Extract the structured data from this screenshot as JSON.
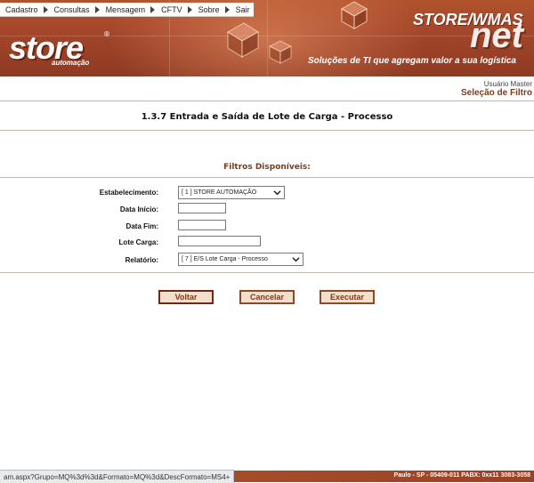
{
  "menu": {
    "items": [
      "Cadastro",
      "Consultas",
      "Mensagem",
      "CFTV",
      "Sobre",
      "Sair"
    ]
  },
  "brand": {
    "logo": "store",
    "logo_reg": "®",
    "logo_sub": "automação",
    "product_top": "STORE/WMAS",
    "product_bottom": "net",
    "tagline": "Soluções de TI que agregam valor a sua logística"
  },
  "header": {
    "user": "Usuário Master",
    "section": "Seleção de Filtro"
  },
  "page": {
    "title": "1.3.7 Entrada e Saída de Lote de Carga - Processo",
    "filters_title": "Filtros Disponíveis:"
  },
  "form": {
    "estabelecimento_label": "Estabelecimento:",
    "estabelecimento_value": "[ 1 ] STORE AUTOMAÇÃO",
    "data_inicio_label": "Data Início:",
    "data_inicio_value": "",
    "data_fim_label": "Data Fim:",
    "data_fim_value": "",
    "lote_carga_label": "Lote Carga:",
    "lote_carga_value": "",
    "relatorio_label": "Relatório:",
    "relatorio_value": "[ 7 ] E/S Lote Carga - Processo"
  },
  "buttons": {
    "voltar": "Voltar",
    "cancelar": "Cancelar",
    "executar": "Executar"
  },
  "footer": {
    "address": "Paulo - SP - 05409-011 PABX: 0xx11 3083-3058"
  },
  "status": {
    "url": "am.aspx?Grupo=MQ%3d%3d&Formato=MQ%3d&DescFormato=MS4+"
  },
  "colors": {
    "brand": "#a2452a",
    "accent_text": "#7a3b1e",
    "button_bg": "#f3e0cc"
  }
}
